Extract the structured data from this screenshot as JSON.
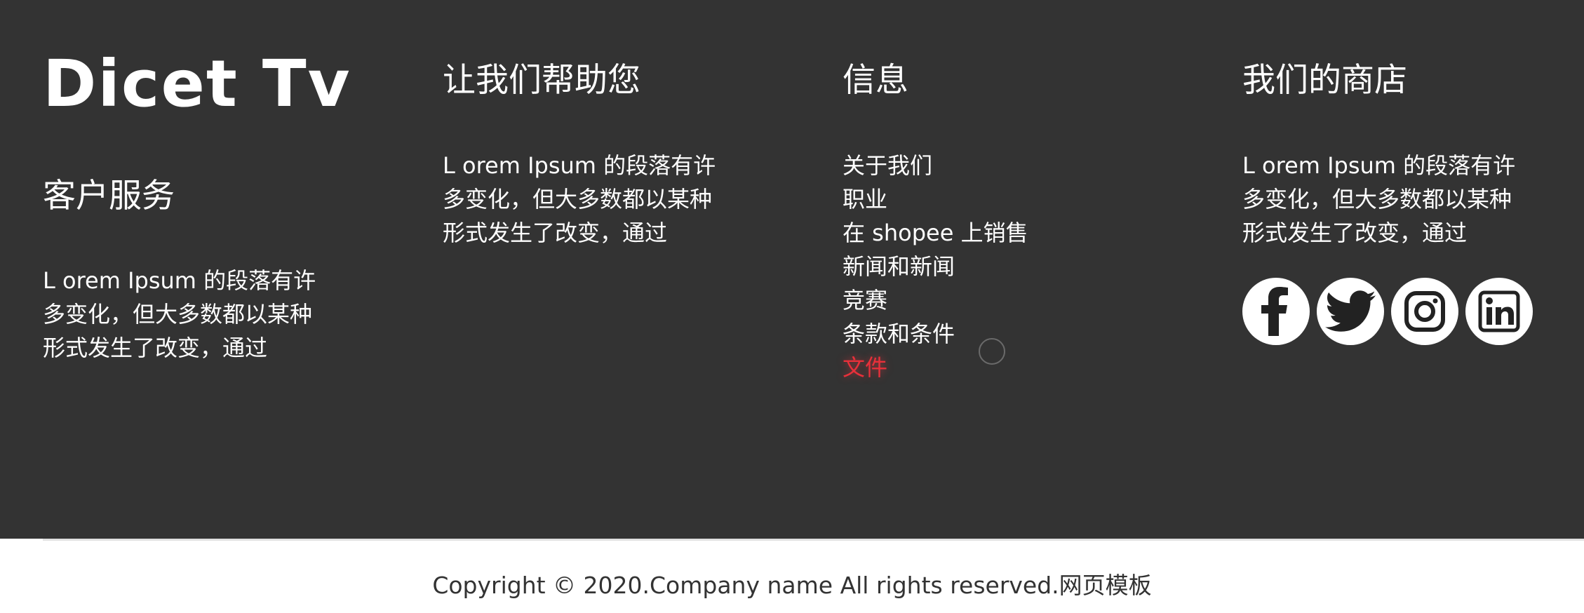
{
  "footer": {
    "background_color": "#333333",
    "brand": {
      "logo_text": "Dicet Tv"
    },
    "customer_service": {
      "title": "客户服务",
      "text": "L orem Ipsum 的段落有许多变化，但大多数都以某种形式发生了改变，通过"
    },
    "help": {
      "title": "让我们帮助您",
      "text": "L orem Ipsum 的段落有许多变化，但大多数都以某种形式发生了改变，通过"
    },
    "info": {
      "title": "信息",
      "links": [
        {
          "label": "关于我们"
        },
        {
          "label": "职业"
        },
        {
          "label": "在 shopee 上销售"
        },
        {
          "label": "新闻和新闻"
        },
        {
          "label": "竞赛"
        },
        {
          "label": "条款和条件"
        },
        {
          "label": "文件",
          "active": true
        }
      ],
      "active_link_color": "#e8303a"
    },
    "store": {
      "title": "我们的商店",
      "text": "L orem Ipsum 的段落有许多变化，但大多数都以某种形式发生了改变，通过",
      "socials": [
        {
          "icon": "facebook-icon"
        },
        {
          "icon": "twitter-icon"
        },
        {
          "icon": "instagram-icon"
        },
        {
          "icon": "linkedin-icon"
        }
      ]
    }
  },
  "bottom_bar": {
    "copyright": "Copyright © 2020.Company name All rights reserved.网页模板"
  }
}
